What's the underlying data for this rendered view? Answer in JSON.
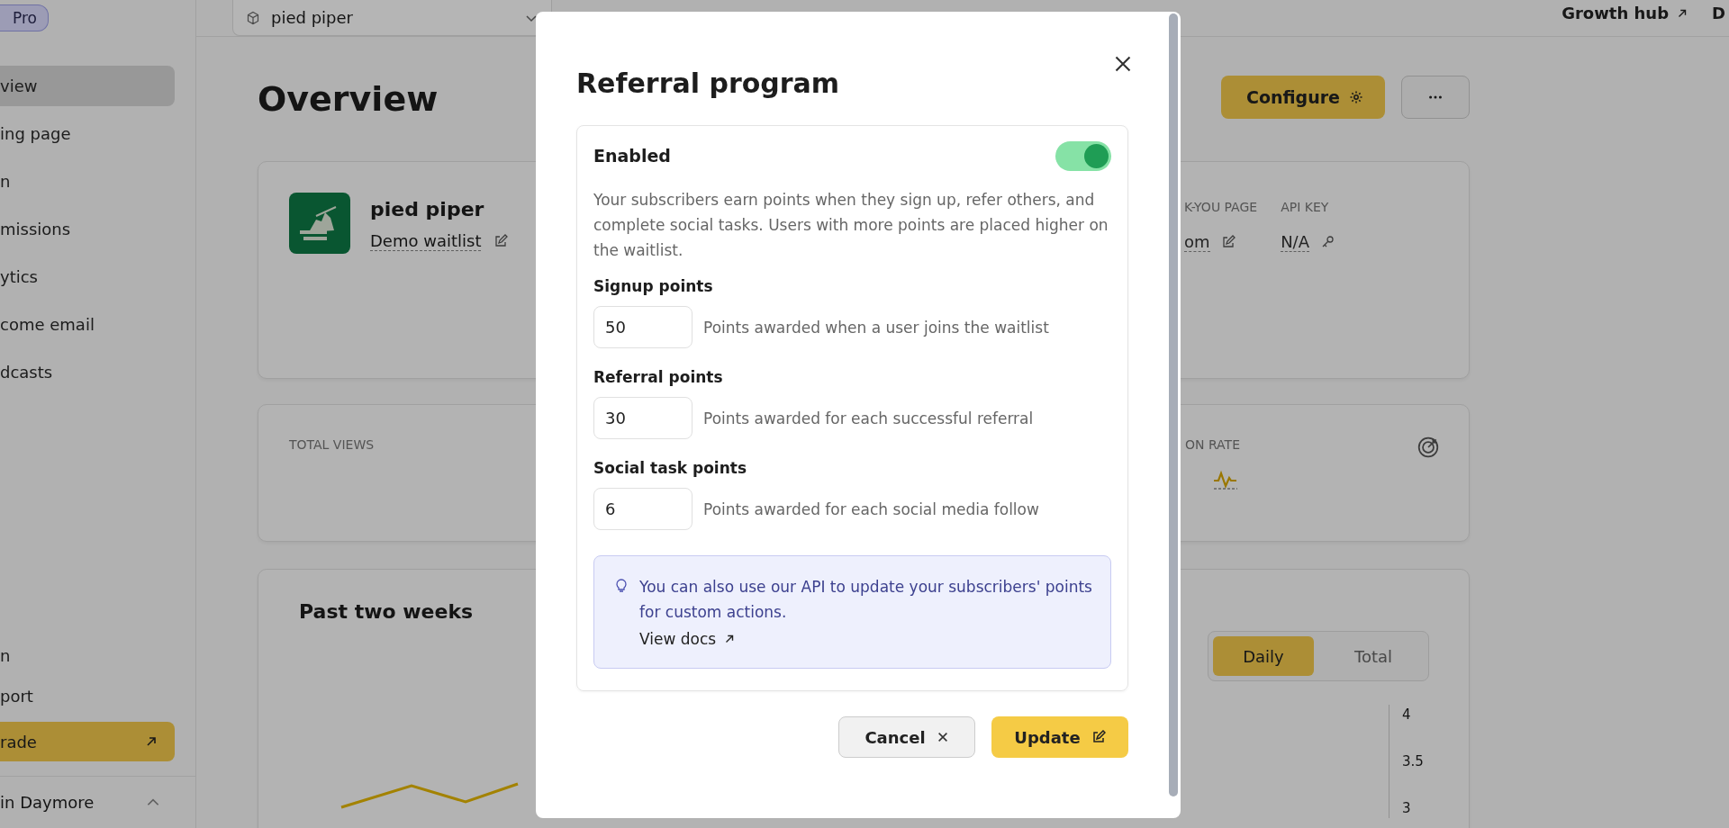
{
  "sidebar": {
    "plan_badge": "Pro",
    "items": [
      {
        "label": "view",
        "selected": true
      },
      {
        "label": "ing page",
        "selected": false
      },
      {
        "label": "n",
        "selected": false
      },
      {
        "label": "missions",
        "selected": false
      },
      {
        "label": "ytics",
        "selected": false
      },
      {
        "label": "come email",
        "selected": false
      },
      {
        "label": "dcasts",
        "selected": false
      }
    ],
    "bottom_items": [
      {
        "label": "n"
      },
      {
        "label": "port"
      }
    ],
    "upgrade_button": "rade",
    "user": {
      "name": "in Daymore"
    }
  },
  "topbar": {
    "project": "pied piper",
    "links": [
      {
        "label": "Growth hub",
        "external": true
      },
      {
        "label": "D",
        "external": false
      }
    ]
  },
  "page": {
    "title": "Overview",
    "configure_button": "Configure",
    "project_card": {
      "name": "pied piper",
      "waitlist": "Demo waitlist",
      "fields": [
        {
          "label": "K-YOU PAGE",
          "value": "om",
          "kind": "edit"
        },
        {
          "label": "API KEY",
          "value": "N/A",
          "kind": "key"
        }
      ]
    },
    "stats_card": {
      "label_left": "TOTAL VIEWS",
      "label_right": "ON RATE"
    },
    "chart_card": {
      "title": "Past two weeks",
      "modes": [
        {
          "label": "Daily",
          "selected": true
        },
        {
          "label": "Total",
          "selected": false
        }
      ],
      "axis_labels": [
        "4",
        "3.5",
        "3"
      ]
    }
  },
  "modal": {
    "title": "Referral program",
    "enabled_label": "Enabled",
    "enabled": true,
    "description": "Your subscribers earn points when they sign up, refer others, and complete social tasks. Users with more points are placed higher on the waitlist.",
    "fields": [
      {
        "label": "Signup points",
        "value": "50",
        "hint": "Points awarded when a user joins the waitlist"
      },
      {
        "label": "Referral points",
        "value": "30",
        "hint": "Points awarded for each successful referral"
      },
      {
        "label": "Social task points",
        "value": "6",
        "hint": "Points awarded for each social media follow"
      }
    ],
    "tip": "You can also use our API to update your subscribers' points for custom actions.",
    "tip_link": "View docs",
    "buttons": [
      {
        "label": "Cancel",
        "kind": "secondary"
      },
      {
        "label": "Update",
        "kind": "primary"
      }
    ]
  }
}
